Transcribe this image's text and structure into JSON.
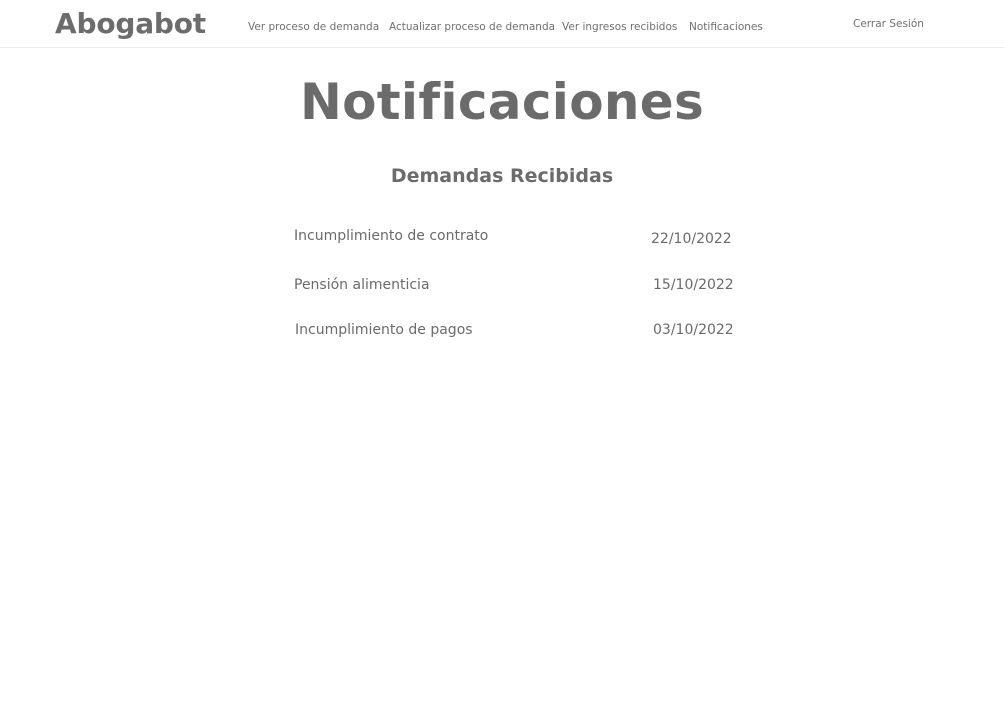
{
  "header": {
    "brand": "Abogabot",
    "nav": [
      {
        "label": "Ver proceso de demanda"
      },
      {
        "label": "Actualizar proceso de demanda"
      },
      {
        "label": "Ver ingresos recibidos"
      },
      {
        "label": "Notificaciones"
      }
    ],
    "logout_label": "Cerrar Sesión"
  },
  "main": {
    "title": "Notificaciones",
    "section_title": "Demandas Recibidas",
    "notifications": [
      {
        "label": "Incumplimiento de contrato",
        "date": "22/10/2022"
      },
      {
        "label": "Pensión alimenticia",
        "date": "15/10/2022"
      },
      {
        "label": "Incumplimiento de pagos",
        "date": "03/10/2022"
      }
    ]
  }
}
